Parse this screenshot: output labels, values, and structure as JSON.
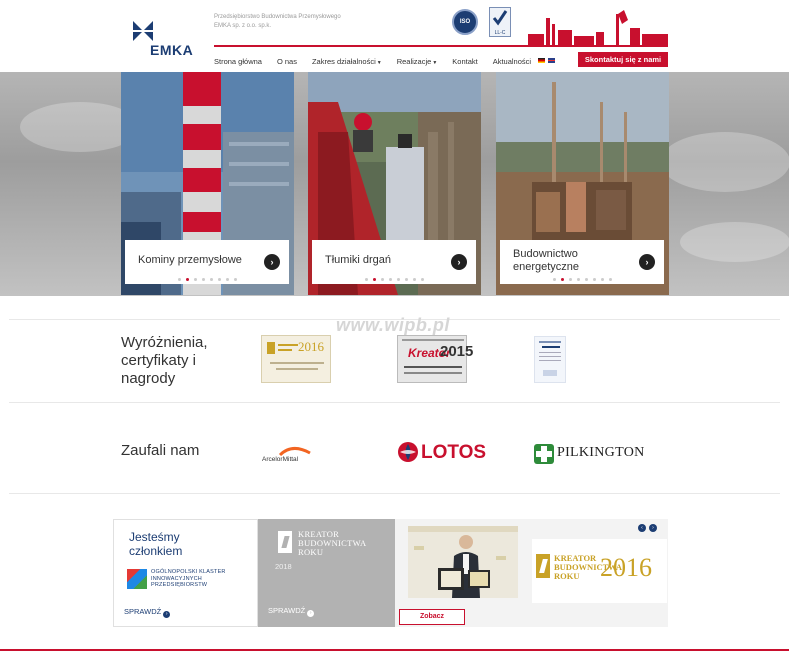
{
  "header": {
    "logo_text": "EMKA",
    "company_name": "Przedsiębiorstwo Budownictwa Przemysłowego EMKA sp. z o.o. sp.k.",
    "iso_badge": "ISO",
    "llc_badge": "LL-C"
  },
  "nav": {
    "items": [
      {
        "label": "Strona główna",
        "dropdown": false
      },
      {
        "label": "O nas",
        "dropdown": false
      },
      {
        "label": "Zakres działalności",
        "dropdown": true
      },
      {
        "label": "Realizacje",
        "dropdown": true
      },
      {
        "label": "Kontakt",
        "dropdown": false
      },
      {
        "label": "Aktualności",
        "dropdown": false
      }
    ],
    "caret": "▼",
    "contact_button": "Skontaktuj się z nami"
  },
  "hero": {
    "cards": [
      {
        "label": "Kominy przemysłowe",
        "active_dot": 1
      },
      {
        "label": "Tłumiki drgań",
        "active_dot": 1
      },
      {
        "label": "Budownictwo energetyczne",
        "active_dot": 1
      }
    ],
    "dot_count": 8,
    "arrow": "›"
  },
  "watermark": "www.wipb.pl",
  "awards": {
    "title": "Wyróżnienia, certyfikaty i nagrody",
    "award1_year": "2016",
    "award2_text": "Kreator",
    "award2_year": "2015"
  },
  "partners": {
    "title": "Zaufali nam",
    "arcelor": "ArcelorMittal",
    "lotos": "LOTOS",
    "pilkington": "PILKINGTON"
  },
  "bottom": {
    "panel1": {
      "title": "Jesteśmy członkiem",
      "klaster": "OGÓLNOPOLSKI KLASTER INNOWACYJNYCH PRZEDSIĘBIORSTW",
      "link": "SPRAWDŹ"
    },
    "panel2": {
      "kreator": "KREATOR BUDOWNICTWA ROKU",
      "year": "2018",
      "link": "SPRAWDŹ"
    },
    "panel3": {
      "kreator": "KREATOR BUDOWNICTWA ROKU",
      "year": "2016",
      "button": "Zobacz",
      "prev": "‹",
      "next": "›"
    }
  },
  "colors": {
    "brand_red": "#c8102e",
    "brand_navy": "#1c3d73",
    "gold": "#c9a227"
  }
}
